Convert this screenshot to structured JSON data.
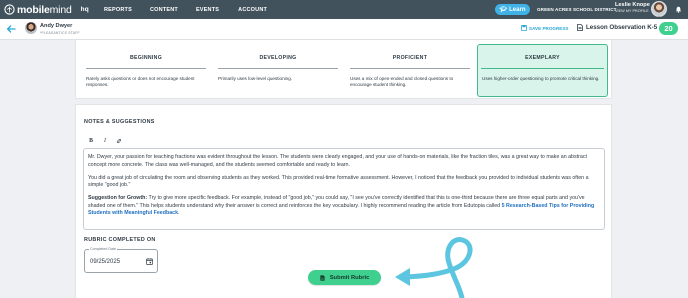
{
  "nav": {
    "brand_bold": "mobile",
    "brand_light": "mind",
    "hq": "hq",
    "items": [
      "REPORTS",
      "CONTENT",
      "EVENTS",
      "ACCOUNT"
    ],
    "learn_label": "Learn",
    "district": "GREEN ACRES SCHOOL DISTRICT",
    "user_name": "Leslie Knope",
    "user_sub": "VIEW MY PROFILE"
  },
  "subheader": {
    "teacher_name": "Andy Dwyer",
    "teacher_role": "*PLEASANTICS STAFF",
    "save_label": "SAVE PROGRESS",
    "doc_title": "Lesson Observation K-5",
    "score": "20"
  },
  "levels": [
    {
      "title": "BEGINNING",
      "desc": "Rarely asks questions or does not encourage student responses.",
      "selected": false
    },
    {
      "title": "DEVELOPING",
      "desc": "Primarily uses low-level questioning.",
      "selected": false
    },
    {
      "title": "PROFICIENT",
      "desc": "Uses a mix of open-ended and closed questions to encourage student thinking.",
      "selected": false
    },
    {
      "title": "EXEMPLARY",
      "desc": "Uses higher-order questioning to promote critical thinking.",
      "selected": true
    }
  ],
  "notes": {
    "label": "NOTES & SUGGESTIONS",
    "toolbar": {
      "bold": "B",
      "italic": "I"
    },
    "p1": "Mr. Dwyer, your passion for teaching fractions was evident throughout the lesson. The students were clearly engaged, and your use of hands-on materials, like the fraction tiles, was a great way to make an abstract concept more concrete. The class was well-managed, and the students seemed comfortable and ready to learn.",
    "p2": "You did a great job of circulating the room and observing students as they worked. This provided real-time formative assessment. However, I noticed that the feedback you provided to individual students was often a simple \"good job.\"",
    "p3_label": "Suggestion for Growth:",
    "p3_body": " Try to give more specific feedback. For example, instead of \"good job,\" you could say, \"I see you've correctly identified that this is one-third because there are three equal parts and you've shaded one of them.\" This helps students understand why their answer is correct and reinforces the key vocabulary. I highly recommend reading the article from Edutopia called ",
    "p3_link": "5 Research-Based Tips for Providing Students with Meaningful Feedback",
    "p3_end": "."
  },
  "rubric_completed": {
    "label": "RUBRIC COMPLETED ON",
    "caption": "Completed Date",
    "date": "09/25/2025"
  },
  "submit_label": "Submit Rubric",
  "icons": {
    "brand": "brain-logo-icon",
    "learn": "graduation-cap-icon",
    "bell": "bell-icon",
    "back": "arrow-left-icon",
    "save": "save-icon",
    "doc": "document-icon",
    "link": "link-icon",
    "calendar": "calendar-icon",
    "submit": "document-icon",
    "annotation": "arrow-annotation"
  },
  "colors": {
    "nav_bg": "#41525d",
    "accent_green": "#3fcf8e",
    "selected_bg": "#d9f4ea",
    "selected_border": "#44b98c",
    "learn_blue": "#3fb2e8",
    "link_blue": "#1f6fbf",
    "annotation_cyan": "#5cc6e0"
  }
}
